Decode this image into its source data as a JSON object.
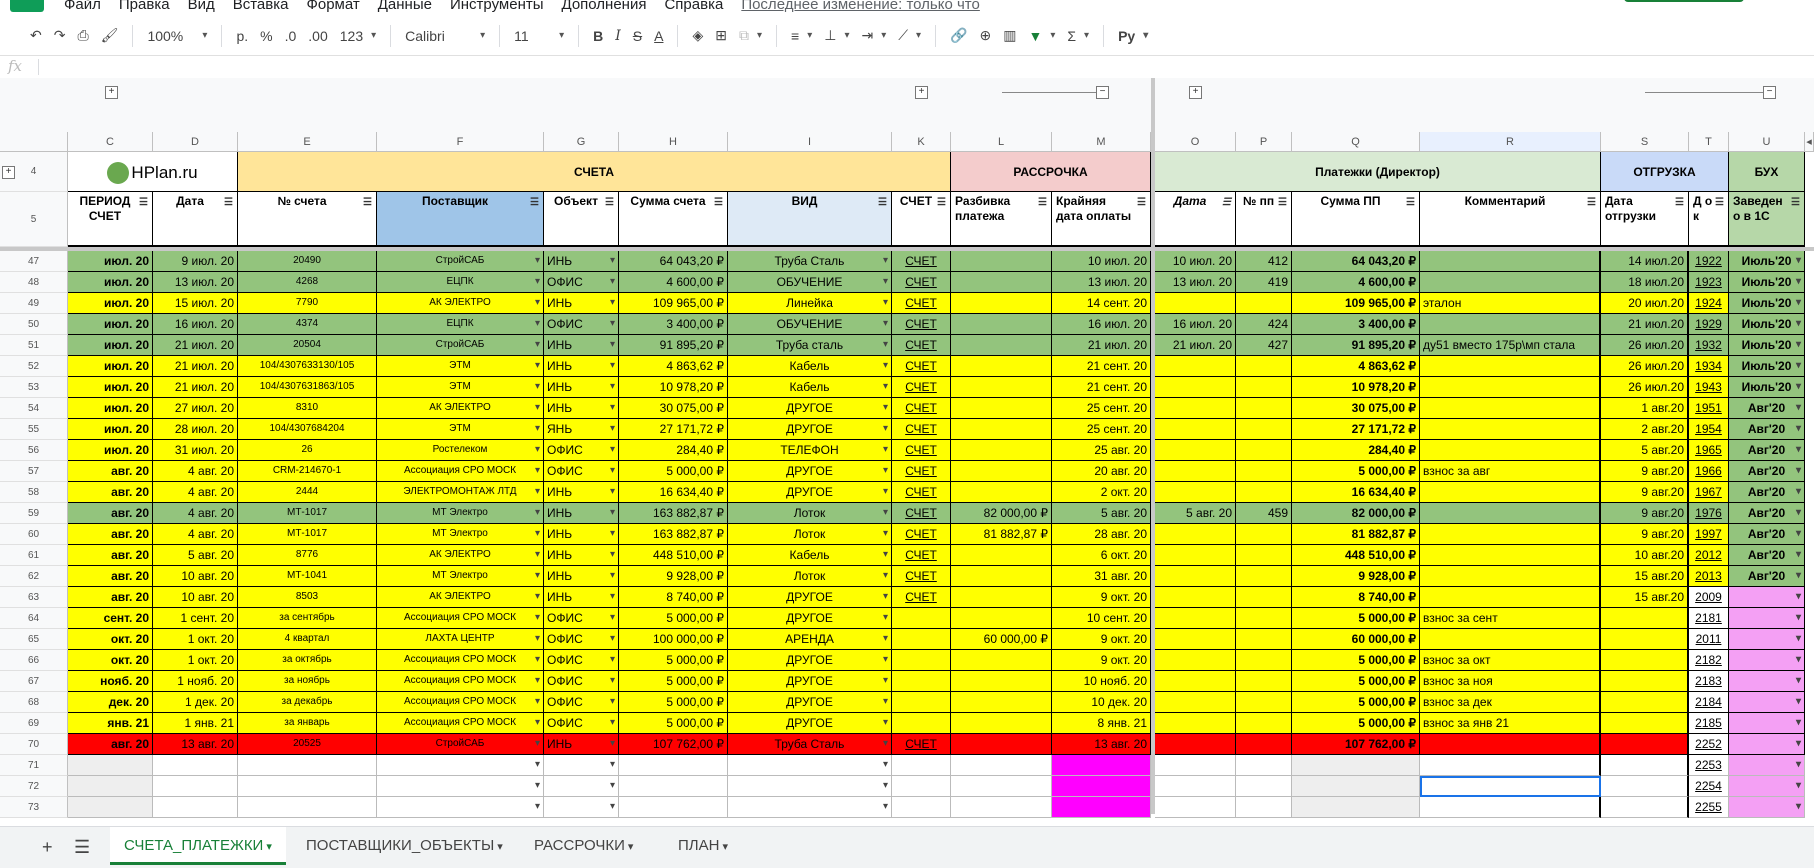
{
  "menu": [
    "Файл",
    "Правка",
    "Вид",
    "Вставка",
    "Формат",
    "Данные",
    "Инструменты",
    "Дополнения",
    "Справка"
  ],
  "menu_last_edit": "Последнее изменение: только что",
  "toolbar": {
    "zoom": "100%",
    "currency": "р.",
    "percent": "%",
    "dec_minus": ".0",
    "dec_plus": ".00",
    "format_more": "123",
    "font": "Calibri",
    "font_size": "11",
    "bold": "B",
    "italic": "I",
    "strike": "S",
    "color": "A",
    "script": "Ру"
  },
  "fx_label": "fx",
  "columns": [
    "C",
    "D",
    "E",
    "F",
    "G",
    "H",
    "I",
    "K",
    "L",
    "M",
    "O",
    "P",
    "Q",
    "R",
    "S",
    "T",
    "U"
  ],
  "header_row4": {
    "row": "4",
    "logo": "HPlan.ru",
    "scheta": "СЧЕТА",
    "rassrochka": "РАССРОЧКА",
    "platezhi": "Платежки (Директор)",
    "otgruzka": "ОТГРУЗКА",
    "buh": "БУХ"
  },
  "header_row5": {
    "row": "5",
    "cols": [
      "ПЕРИОД СЧЕТ",
      "Дата",
      "№ счета",
      "Поставщик",
      "Объект",
      "Сумма счета",
      "ВИД",
      "СЧЕТ",
      "Разбивка платежа",
      "Крайняя дата оплаты",
      "Дата",
      "№ пп",
      "Сумма ПП",
      "Комментарий",
      "Дата отгрузки",
      "Д о к",
      "Заведен о в 1С"
    ]
  },
  "rows": [
    {
      "n": "47",
      "c": "g",
      "v": [
        "июл. 20",
        "9 июл. 20",
        "20490",
        "СтройСАБ",
        "ИНЬ",
        "64 043,20 ₽",
        "Труба Сталь",
        "СЧЕТ",
        "",
        "10 июл. 20",
        "10 июл. 20",
        "412",
        "64 043,20 ₽",
        "",
        "14 июл.20",
        "1922",
        "Июль'20"
      ]
    },
    {
      "n": "48",
      "c": "g",
      "v": [
        "июл. 20",
        "13 июл. 20",
        "4268",
        "ЕЦПК",
        "ОФИС",
        "4 600,00 ₽",
        "ОБУЧЕНИЕ",
        "СЧЕТ",
        "",
        "13 июл. 20",
        "13 июл. 20",
        "419",
        "4 600,00 ₽",
        "",
        "18 июл.20",
        "1923",
        "Июль'20"
      ]
    },
    {
      "n": "49",
      "c": "y",
      "v": [
        "июл. 20",
        "15 июл. 20",
        "7790",
        "АК ЭЛЕКТРО",
        "ИНЬ",
        "109 965,00 ₽",
        "Линейка",
        "СЧЕТ",
        "",
        "14 сент. 20",
        "",
        "",
        "109 965,00 ₽",
        "эталон",
        "20 июл.20",
        "1924",
        "Июль'20"
      ]
    },
    {
      "n": "50",
      "c": "g",
      "v": [
        "июл. 20",
        "16 июл. 20",
        "4374",
        "ЕЦПК",
        "ОФИС",
        "3 400,00 ₽",
        "ОБУЧЕНИЕ",
        "СЧЕТ",
        "",
        "16 июл. 20",
        "16 июл. 20",
        "424",
        "3 400,00 ₽",
        "",
        "21 июл.20",
        "1929",
        "Июль'20"
      ]
    },
    {
      "n": "51",
      "c": "g",
      "v": [
        "июл. 20",
        "21 июл. 20",
        "20504",
        "СтройСАБ",
        "ИНЬ",
        "91 895,20 ₽",
        "Труба сталь",
        "СЧЕТ",
        "",
        "21 июл. 20",
        "21 июл. 20",
        "427",
        "91 895,20 ₽",
        "ду51 вместо 175р\\мп стала",
        "26 июл.20",
        "1932",
        "Июль'20"
      ]
    },
    {
      "n": "52",
      "c": "y",
      "v": [
        "июл. 20",
        "21 июл. 20",
        "104/4307633130/105",
        "ЭТМ",
        "ИНЬ",
        "4 863,62 ₽",
        "Кабель",
        "СЧЕТ",
        "",
        "21 сент. 20",
        "",
        "",
        "4 863,62 ₽",
        "",
        "26 июл.20",
        "1934",
        "Июль'20"
      ]
    },
    {
      "n": "53",
      "c": "y",
      "v": [
        "июл. 20",
        "21 июл. 20",
        "104/4307631863/105",
        "ЭТМ",
        "ИНЬ",
        "10 978,20 ₽",
        "Кабель",
        "СЧЕТ",
        "",
        "21 сент. 20",
        "",
        "",
        "10 978,20 ₽",
        "",
        "26 июл.20",
        "1943",
        "Июль'20"
      ]
    },
    {
      "n": "54",
      "c": "y",
      "v": [
        "июл. 20",
        "27 июл. 20",
        "8310",
        "АК ЭЛЕКТРО",
        "ИНЬ",
        "30 075,00 ₽",
        "ДРУГОЕ",
        "СЧЕТ",
        "",
        "25 сент. 20",
        "",
        "",
        "30 075,00 ₽",
        "",
        "1 авг.20",
        "1951",
        "Авг'20"
      ]
    },
    {
      "n": "55",
      "c": "y",
      "v": [
        "июл. 20",
        "28 июл. 20",
        "104/4307684204",
        "ЭТМ",
        "ЯНЬ",
        "27 171,72 ₽",
        "ДРУГОЕ",
        "СЧЕТ",
        "",
        "25 сент. 20",
        "",
        "",
        "27 171,72 ₽",
        "",
        "2 авг.20",
        "1954",
        "Авг'20"
      ]
    },
    {
      "n": "56",
      "c": "y",
      "v": [
        "июл. 20",
        "31 июл. 20",
        "26",
        "Ростелеком",
        "ОФИС",
        "284,40 ₽",
        "ТЕЛЕФОН",
        "СЧЕТ",
        "",
        "25 авг. 20",
        "",
        "",
        "284,40 ₽",
        "",
        "5 авг.20",
        "1965",
        "Авг'20"
      ]
    },
    {
      "n": "57",
      "c": "y",
      "v": [
        "авг. 20",
        "4 авг. 20",
        "CRM-214670-1",
        "Ассоциация СРО МОСК",
        "ОФИС",
        "5 000,00 ₽",
        "ДРУГОЕ",
        "СЧЕТ",
        "",
        "20 авг. 20",
        "",
        "",
        "5 000,00 ₽",
        "взнос за авг",
        "9 авг.20",
        "1966",
        "Авг'20"
      ]
    },
    {
      "n": "58",
      "c": "y",
      "v": [
        "авг. 20",
        "4 авг. 20",
        "2444",
        "ЭЛЕКТРОМОНТАЖ ЛТД",
        "ИНЬ",
        "16 634,40 ₽",
        "ДРУГОЕ",
        "СЧЕТ",
        "",
        "2 окт. 20",
        "",
        "",
        "16 634,40 ₽",
        "",
        "9 авг.20",
        "1967",
        "Авг'20"
      ]
    },
    {
      "n": "59",
      "c": "g",
      "v": [
        "авг. 20",
        "4 авг. 20",
        "МТ-1017",
        "МТ Электро",
        "ИНЬ",
        "163 882,87 ₽",
        "Лоток",
        "СЧЕТ",
        "82 000,00 ₽",
        "5 авг. 20",
        "5 авг. 20",
        "459",
        "82 000,00 ₽",
        "",
        "9 авг.20",
        "1976",
        "Авг'20"
      ]
    },
    {
      "n": "60",
      "c": "y",
      "v": [
        "авг. 20",
        "4 авг. 20",
        "МТ-1017",
        "МТ Электро",
        "ИНЬ",
        "163 882,87 ₽",
        "Лоток",
        "СЧЕТ",
        "81 882,87 ₽",
        "28 авг. 20",
        "",
        "",
        "81 882,87 ₽",
        "",
        "9 авг.20",
        "1997",
        "Авг'20"
      ]
    },
    {
      "n": "61",
      "c": "y",
      "v": [
        "авг. 20",
        "5 авг. 20",
        "8776",
        "АК ЭЛЕКТРО",
        "ИНЬ",
        "448 510,00 ₽",
        "Кабель",
        "СЧЕТ",
        "",
        "6 окт. 20",
        "",
        "",
        "448 510,00 ₽",
        "",
        "10 авг.20",
        "2012",
        "Авг'20"
      ]
    },
    {
      "n": "62",
      "c": "y",
      "v": [
        "авг. 20",
        "10 авг. 20",
        "МТ-1041",
        "МТ Электро",
        "ИНЬ",
        "9 928,00 ₽",
        "Лоток",
        "СЧЕТ",
        "",
        "31 авг. 20",
        "",
        "",
        "9 928,00 ₽",
        "",
        "15 авг.20",
        "2013",
        "Авг'20"
      ]
    },
    {
      "n": "63",
      "c": "y",
      "p": true,
      "v": [
        "авг. 20",
        "10 авг. 20",
        "8503",
        "АК ЭЛЕКТРО",
        "ИНЬ",
        "8 740,00 ₽",
        "ДРУГОЕ",
        "СЧЕТ",
        "",
        "9 окт. 20",
        "",
        "",
        "8 740,00 ₽",
        "",
        "15 авг.20",
        "2009",
        ""
      ]
    },
    {
      "n": "64",
      "c": "y",
      "p": true,
      "v": [
        "сент. 20",
        "1 сент. 20",
        "за сентябрь",
        "Ассоциация СРО МОСК",
        "ОФИС",
        "5 000,00 ₽",
        "ДРУГОЕ",
        "",
        "",
        "10 сент. 20",
        "",
        "",
        "5 000,00 ₽",
        "взнос за сент",
        "",
        "2181",
        ""
      ]
    },
    {
      "n": "65",
      "c": "y",
      "p": true,
      "v": [
        "окт. 20",
        "1 окт. 20",
        "4 квартал",
        "ЛАХТА ЦЕНТР",
        "ОФИС",
        "100 000,00 ₽",
        "АРЕНДА",
        "",
        "60 000,00 ₽",
        "9 окт. 20",
        "",
        "",
        "60 000,00 ₽",
        "",
        "",
        "2011",
        ""
      ]
    },
    {
      "n": "66",
      "c": "y",
      "p": true,
      "v": [
        "окт. 20",
        "1 окт. 20",
        "за октябрь",
        "Ассоциация СРО МОСК",
        "ОФИС",
        "5 000,00 ₽",
        "ДРУГОЕ",
        "",
        "",
        "9 окт. 20",
        "",
        "",
        "5 000,00 ₽",
        "взнос за окт",
        "",
        "2182",
        ""
      ]
    },
    {
      "n": "67",
      "c": "y",
      "p": true,
      "v": [
        "нояб. 20",
        "1 нояб. 20",
        "за ноябрь",
        "Ассоциация СРО МОСК",
        "ОФИС",
        "5 000,00 ₽",
        "ДРУГОЕ",
        "",
        "",
        "10 нояб. 20",
        "",
        "",
        "5 000,00 ₽",
        "взнос за ноя",
        "",
        "2183",
        ""
      ]
    },
    {
      "n": "68",
      "c": "y",
      "p": true,
      "v": [
        "дек. 20",
        "1 дек. 20",
        "за декабрь",
        "Ассоциация СРО МОСК",
        "ОФИС",
        "5 000,00 ₽",
        "ДРУГОЕ",
        "",
        "",
        "10 дек. 20",
        "",
        "",
        "5 000,00 ₽",
        "взнос за дек",
        "",
        "2184",
        ""
      ]
    },
    {
      "n": "69",
      "c": "y",
      "p": true,
      "v": [
        "янв. 21",
        "1 янв. 21",
        "за январь",
        "Ассоциация СРО МОСК",
        "ОФИС",
        "5 000,00 ₽",
        "ДРУГОЕ",
        "",
        "",
        "8 янв. 21",
        "",
        "",
        "5 000,00 ₽",
        "взнос за янв 21",
        "",
        "2185",
        ""
      ]
    },
    {
      "n": "70",
      "c": "r",
      "p": true,
      "v": [
        "авг. 20",
        "13 авг. 20",
        "20525",
        "СтройСАБ",
        "ИНЬ",
        "107 762,00 ₽",
        "Труба Сталь",
        "СЧЕТ",
        "",
        "13 авг. 20",
        "",
        "",
        "107 762,00 ₽",
        "",
        "",
        "2252",
        ""
      ]
    },
    {
      "n": "71",
      "c": "w",
      "p": true,
      "v": [
        "",
        "",
        "",
        "",
        "",
        "",
        "",
        "",
        "",
        "",
        "",
        "",
        "",
        "",
        "",
        "2253",
        ""
      ]
    },
    {
      "n": "72",
      "c": "w",
      "p": true,
      "v": [
        "",
        "",
        "",
        "",
        "",
        "",
        "",
        "",
        "",
        "",
        "",
        "",
        "",
        "",
        "",
        "2254",
        ""
      ]
    },
    {
      "n": "73",
      "c": "w",
      "p": true,
      "v": [
        "",
        "",
        "",
        "",
        "",
        "",
        "",
        "",
        "",
        "",
        "",
        "",
        "",
        "",
        "",
        "2255",
        ""
      ]
    }
  ],
  "tabs": [
    "СЧЕТА_ПЛАТЕЖКИ",
    "ПОСТАВЩИКИ_ОБЪЕКТЫ",
    "РАССРОЧКИ",
    "ПЛАН"
  ],
  "colors": {
    "green": "#93c47d",
    "yellow": "#ffff00",
    "red": "#ff0000",
    "pink": "#ff00ff",
    "lightpink": "#f4a0f4",
    "blue": "#9fc5e8",
    "orange": "#ffe599",
    "salmon": "#f4cccc",
    "mint": "#d9ead3",
    "lavender": "#c9daf8",
    "lightgreen": "#b6d7a8"
  }
}
